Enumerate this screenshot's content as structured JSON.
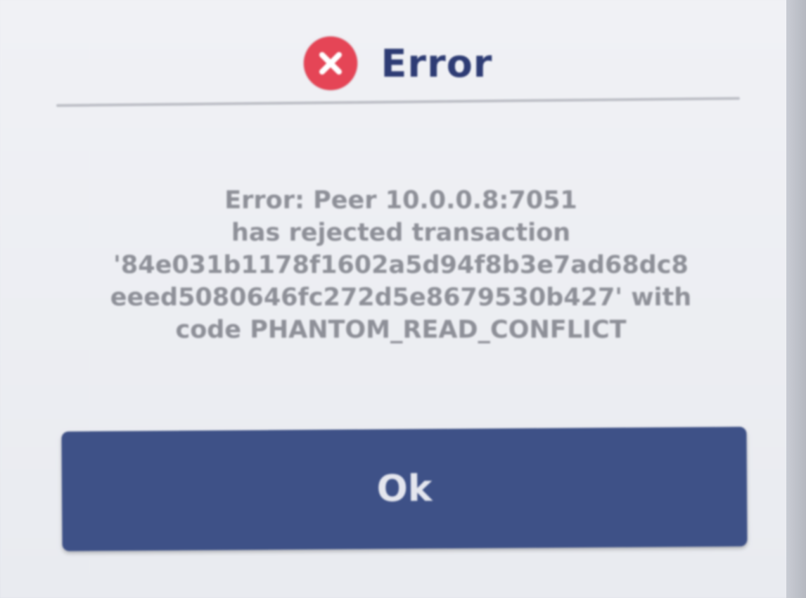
{
  "dialog": {
    "title": "Error",
    "icon": "error-circle-x-icon",
    "accent_color": "#e54556",
    "title_color": "#2e3c74",
    "message_lines": [
      "Error: Peer 10.0.0.8:7051",
      "has rejected transaction",
      "'84e031b1178f1602a5d94f8b3e7ad68dc8",
      "eeed5080646fc272d5e8679530b427' with",
      "code PHANTOM_READ_CONFLICT"
    ],
    "ok_label": "Ok",
    "button_color": "#3e5187"
  }
}
